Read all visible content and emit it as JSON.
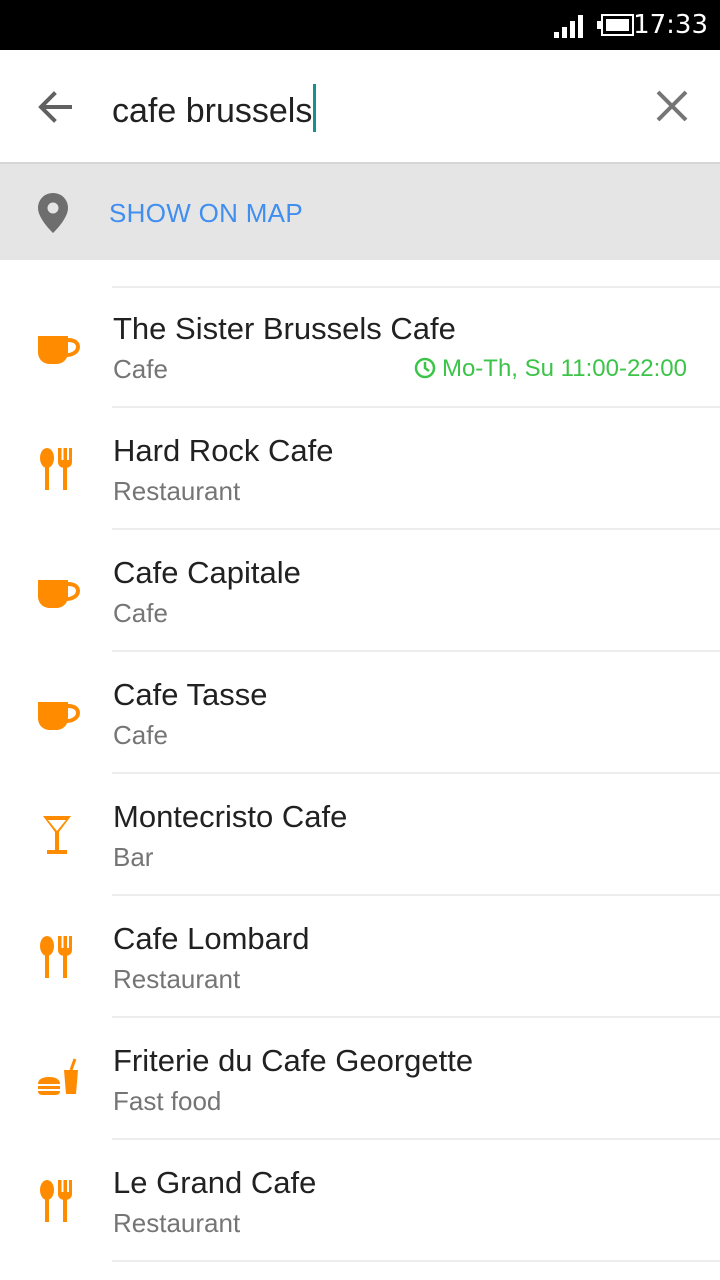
{
  "status_bar": {
    "time": "17:33",
    "icons": [
      "signal-icon",
      "battery-icon"
    ]
  },
  "search": {
    "query": "cafe brussels",
    "back_icon": "arrow-left-icon",
    "clear_icon": "close-icon"
  },
  "show_on_map": {
    "label": "SHOW ON MAP",
    "icon": "map-pin-icon"
  },
  "colors": {
    "accent_orange": "#ff8c00",
    "link_blue": "#3f8ef0",
    "open_hours_green": "#3cc448",
    "caret_teal": "#19918b"
  },
  "results": [
    {
      "name": "The Sister Brussels Cafe",
      "category": "Cafe",
      "icon": "cafe-cup-icon",
      "hours": "Mo-Th, Su 11:00-22:00"
    },
    {
      "name": "Hard Rock Cafe",
      "category": "Restaurant",
      "icon": "restaurant-icon"
    },
    {
      "name": "Cafe Capitale",
      "category": "Cafe",
      "icon": "cafe-cup-icon"
    },
    {
      "name": "Cafe Tasse",
      "category": "Cafe",
      "icon": "cafe-cup-icon"
    },
    {
      "name": "Montecristo Cafe",
      "category": "Bar",
      "icon": "cocktail-icon"
    },
    {
      "name": "Cafe Lombard",
      "category": "Restaurant",
      "icon": "restaurant-icon"
    },
    {
      "name": "Friterie du Cafe Georgette",
      "category": "Fast food",
      "icon": "fast-food-icon"
    },
    {
      "name": "Le Grand Cafe",
      "category": "Restaurant",
      "icon": "restaurant-icon"
    }
  ]
}
